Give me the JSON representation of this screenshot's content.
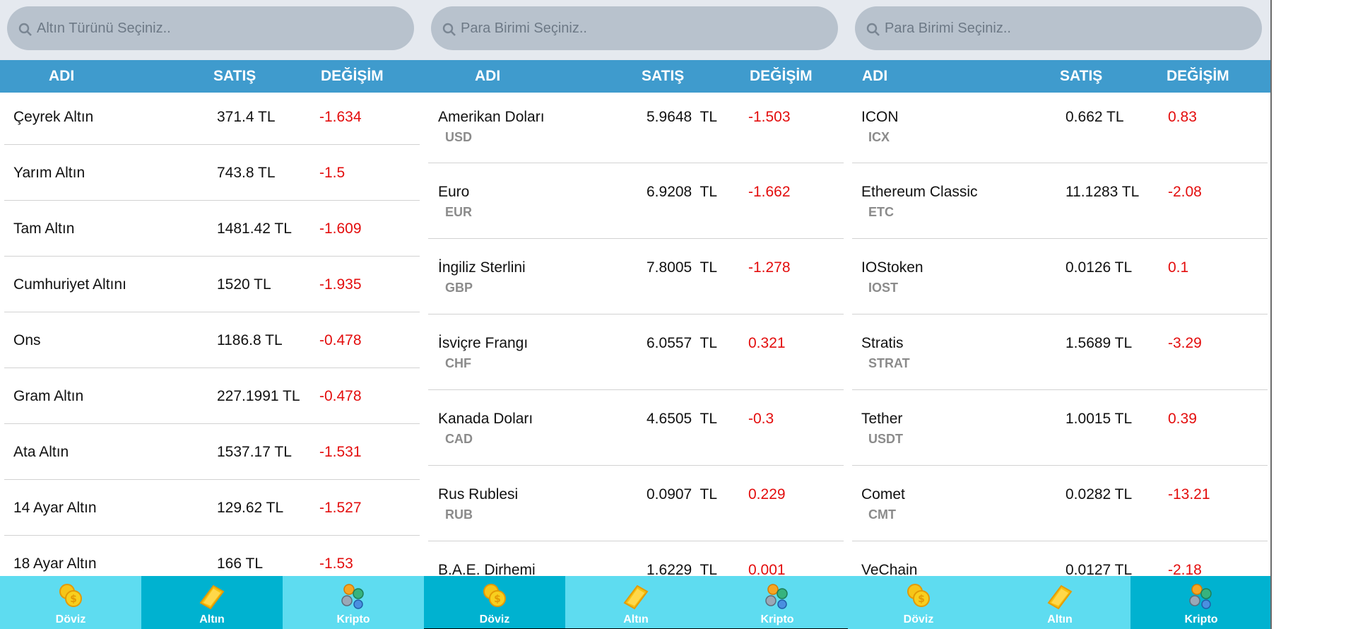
{
  "colors": {
    "header": "#3f9bcd",
    "nav_bg": "#5edcf0",
    "nav_active": "#00b2d0",
    "change_text": "#e30d0d",
    "search_bg": "#b8c2cd"
  },
  "panels": [
    {
      "search_placeholder": "Altın Türünü Seçiniz..",
      "columns": {
        "name": "ADI",
        "price": "SATIŞ",
        "change": "DEĞİŞİM"
      },
      "rows": [
        {
          "name": "Çeyrek Altın",
          "price": "371.4 TL",
          "change": "-1.634"
        },
        {
          "name": "Yarım Altın",
          "price": "743.8 TL",
          "change": "-1.5"
        },
        {
          "name": "Tam Altın",
          "price": "1481.42 TL",
          "change": "-1.609"
        },
        {
          "name": "Cumhuriyet Altını",
          "price": "1520 TL",
          "change": "-1.935"
        },
        {
          "name": "Ons",
          "price": "1186.8 TL",
          "change": "-0.478"
        },
        {
          "name": "Gram Altın",
          "price": "227.1991 TL",
          "change": "-0.478"
        },
        {
          "name": "Ata Altın",
          "price": "1537.17 TL",
          "change": "-1.531"
        },
        {
          "name": "14 Ayar Altın",
          "price": "129.62 TL",
          "change": "-1.527"
        },
        {
          "name": "18 Ayar Altın",
          "price": "166 TL",
          "change": "-1.53"
        }
      ],
      "nav": {
        "active": "Altın",
        "items": [
          {
            "label": "Döviz",
            "icon": "coins-icon"
          },
          {
            "label": "Altın",
            "icon": "gold-bar-icon"
          },
          {
            "label": "Kripto",
            "icon": "crypto-coins-icon"
          }
        ]
      }
    },
    {
      "search_placeholder": "Para Birimi Seçiniz..",
      "columns": {
        "name": "ADI",
        "price": "SATIŞ",
        "change": "DEĞİŞİM"
      },
      "rows": [
        {
          "name": "Amerikan Doları",
          "code": "USD",
          "price": "5.9648  TL",
          "change": "-1.503"
        },
        {
          "name": "Euro",
          "code": "EUR",
          "price": "6.9208  TL",
          "change": "-1.662"
        },
        {
          "name": "İngiliz Sterlini",
          "code": "GBP",
          "price": "7.8005  TL",
          "change": "-1.278"
        },
        {
          "name": "İsviçre Frangı",
          "code": "CHF",
          "price": "6.0557  TL",
          "change": "0.321"
        },
        {
          "name": "Kanada Doları",
          "code": "CAD",
          "price": "4.6505  TL",
          "change": "-0.3"
        },
        {
          "name": "Rus Rublesi",
          "code": "RUB",
          "price": "0.0907  TL",
          "change": "0.229"
        },
        {
          "name": "B.A.E. Dirhemi",
          "code": "",
          "price": "1.6229  TL",
          "change": "0.001"
        }
      ],
      "nav": {
        "active": "Döviz",
        "items": [
          {
            "label": "Döviz",
            "icon": "coins-icon"
          },
          {
            "label": "Altın",
            "icon": "gold-bar-icon"
          },
          {
            "label": "Kripto",
            "icon": "crypto-coins-icon"
          }
        ]
      }
    },
    {
      "search_placeholder": "Para Birimi Seçiniz..",
      "columns": {
        "name": "ADI",
        "price": "SATIŞ",
        "change": "DEĞİŞİM"
      },
      "rows": [
        {
          "name": "ICON",
          "code": "ICX",
          "price": "0.662 TL",
          "change": "0.83"
        },
        {
          "name": "Ethereum Classic",
          "code": "ETC",
          "price": "11.1283 TL",
          "change": "-2.08"
        },
        {
          "name": "IOStoken",
          "code": "IOST",
          "price": "0.0126 TL",
          "change": "0.1"
        },
        {
          "name": "Stratis",
          "code": "STRAT",
          "price": "1.5689 TL",
          "change": "-3.29"
        },
        {
          "name": "Tether",
          "code": "USDT",
          "price": "1.0015 TL",
          "change": "0.39"
        },
        {
          "name": "Comet",
          "code": "CMT",
          "price": "0.0282 TL",
          "change": "-13.21"
        },
        {
          "name": "VeChain",
          "code": "",
          "price": "0.0127 TL",
          "change": "-2.18"
        }
      ],
      "nav": {
        "active": "Kripto",
        "items": [
          {
            "label": "Döviz",
            "icon": "coins-icon"
          },
          {
            "label": "Altın",
            "icon": "gold-bar-icon"
          },
          {
            "label": "Kripto",
            "icon": "crypto-coins-icon"
          }
        ]
      }
    }
  ]
}
